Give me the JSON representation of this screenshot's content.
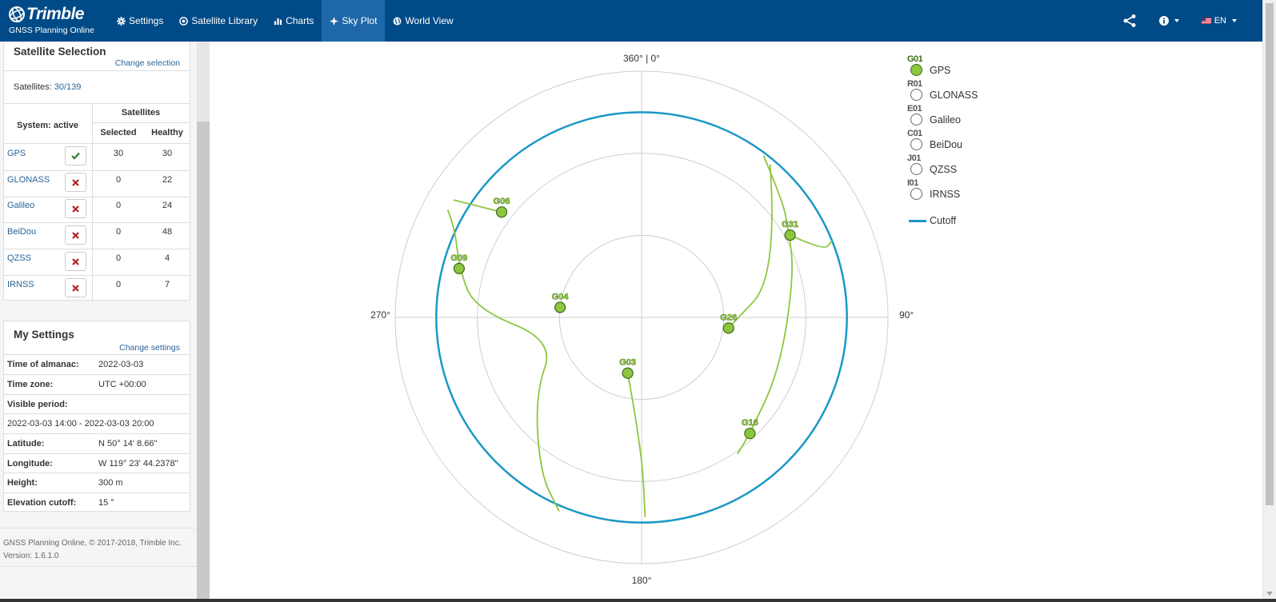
{
  "brand": {
    "name": "Trimble",
    "subtitle": "GNSS Planning Online"
  },
  "nav": {
    "items": [
      {
        "label": "Settings",
        "icon": "gear-icon"
      },
      {
        "label": "Satellite Library",
        "icon": "satellite-icon"
      },
      {
        "label": "Charts",
        "icon": "bar-chart-icon"
      },
      {
        "label": "Sky Plot",
        "icon": "crosshair-icon",
        "active": true
      },
      {
        "label": "World View",
        "icon": "globe-icon"
      }
    ],
    "share_icon": "share-icon",
    "info_icon": "info-icon",
    "language": "EN"
  },
  "satellite_selection": {
    "title": "Satellite Selection",
    "change_link": "Change selection",
    "count_label": "Satellites: ",
    "count_value": "30/139",
    "header_system": "System: active",
    "header_satellites": "Satellites",
    "header_selected": "Selected",
    "header_healthy": "Healthy",
    "systems": [
      {
        "name": "GPS",
        "active": true,
        "selected": "30",
        "healthy": "30"
      },
      {
        "name": "GLONASS",
        "active": false,
        "selected": "0",
        "healthy": "22"
      },
      {
        "name": "Galileo",
        "active": false,
        "selected": "0",
        "healthy": "24"
      },
      {
        "name": "BeiDou",
        "active": false,
        "selected": "0",
        "healthy": "48"
      },
      {
        "name": "QZSS",
        "active": false,
        "selected": "0",
        "healthy": "4"
      },
      {
        "name": "IRNSS",
        "active": false,
        "selected": "0",
        "healthy": "7"
      }
    ]
  },
  "my_settings": {
    "title": "My Settings",
    "change_link": "Change settings",
    "time_of_almanac_label": "Time of almanac:",
    "time_of_almanac": "2022-03-03",
    "time_zone_label": "Time zone:",
    "time_zone": "UTC +00:00",
    "visible_period_label": "Visible period:",
    "visible_period": "2022-03-03 14:00 - 2022-03-03 20:00",
    "latitude_label": "Latitude:",
    "latitude": "N 50° 14' 8.66\"",
    "longitude_label": "Longitude:",
    "longitude": "W 119° 23' 44.2378\"",
    "height_label": "Height:",
    "height": "300 m",
    "elevation_cutoff_label": "Elevation cutoff:",
    "elevation_cutoff": "15 °"
  },
  "footer": {
    "text": "GNSS Planning Online, © 2017-2018, Trimble Inc. Version: 1.6.1.0"
  },
  "skyplot": {
    "north_label": "360° | 0°",
    "east_label": "90°",
    "south_label": "180°",
    "west_label": "270°",
    "cutoff_color": "#1b98c7",
    "track_color": "#8dc63f"
  },
  "legend": [
    {
      "tag": "G01",
      "label": "GPS",
      "on": true
    },
    {
      "tag": "R01",
      "label": "GLONASS",
      "on": false
    },
    {
      "tag": "E01",
      "label": "Galileo",
      "on": false
    },
    {
      "tag": "C01",
      "label": "BeiDou",
      "on": false
    },
    {
      "tag": "J01",
      "label": "QZSS",
      "on": false
    },
    {
      "tag": "I01",
      "label": "IRNSS",
      "on": false
    }
  ],
  "legend_cutoff": "Cutoff",
  "chart_data": {
    "type": "scatter",
    "projection": "polar-sky",
    "elevation_cutoff": 15,
    "rings_elevation": [
      0,
      30,
      60
    ],
    "azimuth_labels": [
      "360° | 0°",
      "90°",
      "180°",
      "270°"
    ],
    "satellites": [
      {
        "name": "G06",
        "az": 307,
        "el": 26,
        "track": [
          [
            307,
            26
          ],
          [
            302,
            9
          ]
        ]
      },
      {
        "name": "G09",
        "az": 285,
        "el": 21,
        "track": [
          [
            299,
            9
          ],
          [
            296,
            14
          ],
          [
            285,
            21
          ],
          [
            273,
            29
          ],
          [
            255,
            57
          ],
          [
            234,
            42
          ],
          [
            213,
            22
          ],
          [
            203,
            13
          ]
        ]
      },
      {
        "name": "G04",
        "az": 277,
        "el": 60
      },
      {
        "name": "G03",
        "az": 194,
        "el": 69,
        "track": [
          [
            194,
            69
          ],
          [
            180,
            42
          ],
          [
            179,
            17
          ]
        ]
      },
      {
        "name": "G16",
        "az": 137,
        "el": 32,
        "track": [
          [
            37,
            16
          ],
          [
            50,
            23
          ],
          [
            58,
            27
          ],
          [
            74,
            32
          ],
          [
            111,
            36
          ],
          [
            137,
            32
          ],
          [
            145,
            29
          ]
        ]
      },
      {
        "name": "G31",
        "az": 61,
        "el": 28,
        "track": [
          [
            61,
            28
          ],
          [
            70,
            19
          ],
          [
            68,
            15
          ]
        ]
      },
      {
        "name": "G26",
        "az": 97,
        "el": 58,
        "track": [
          [
            40,
            17
          ],
          [
            73,
            38
          ],
          [
            97,
            58
          ]
        ]
      }
    ]
  }
}
